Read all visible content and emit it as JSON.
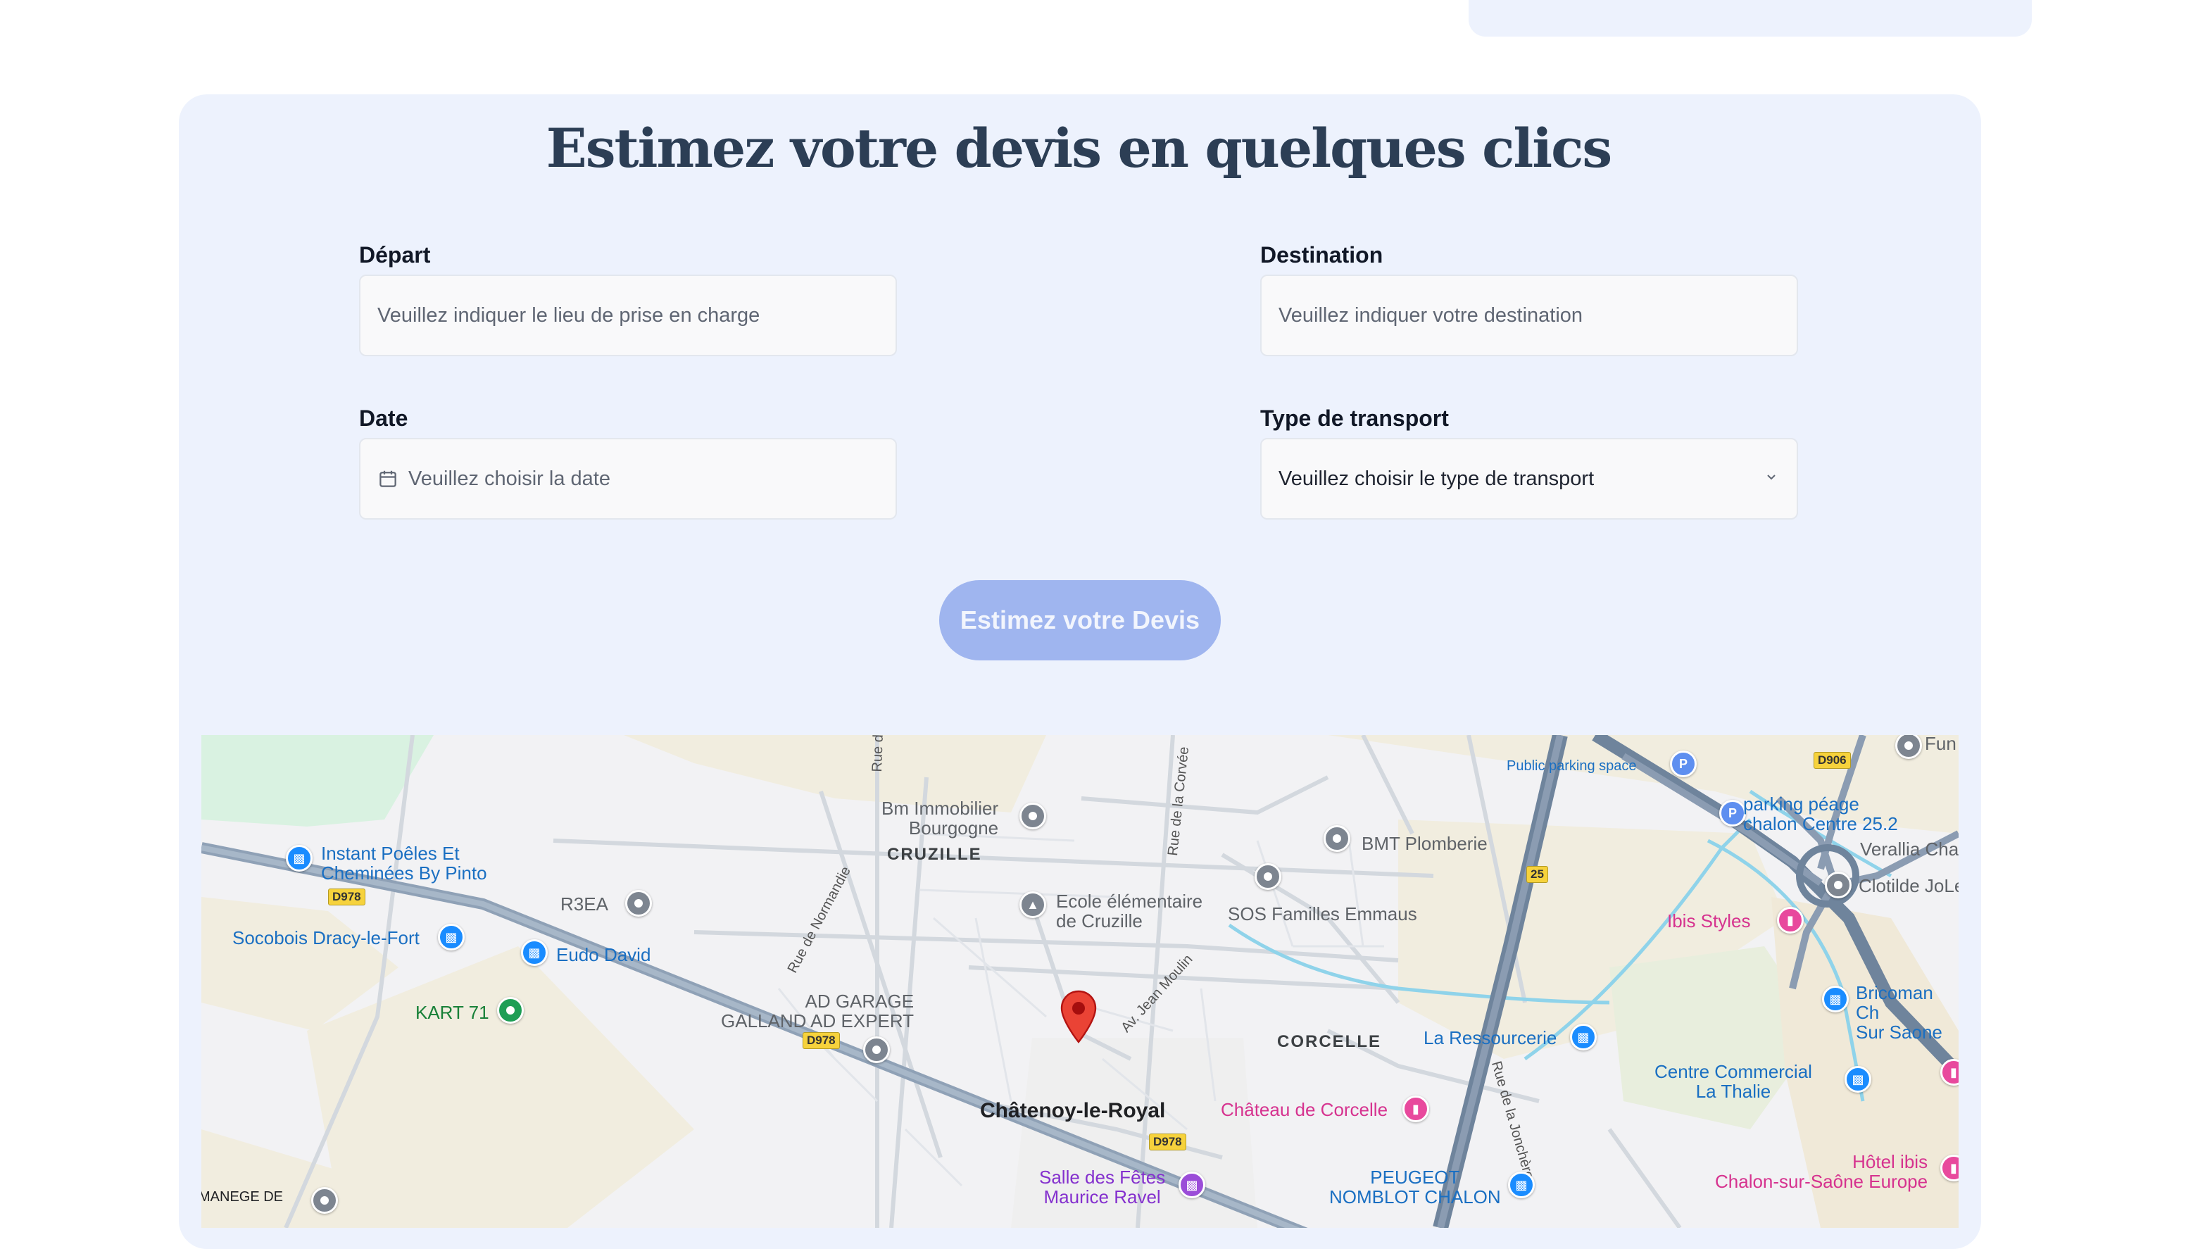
{
  "form": {
    "title": "Estimez votre devis en quelques clics",
    "depart_label": "Départ",
    "depart_placeholder": "Veuillez indiquer le lieu de prise en charge",
    "destination_label": "Destination",
    "destination_placeholder": "Veuillez indiquer votre destination",
    "date_label": "Date",
    "date_placeholder": "Veuillez choisir la date",
    "transport_label": "Type de transport",
    "transport_value": "Veuillez choisir le type de transport",
    "submit_label": "Estimez votre Devis"
  },
  "map": {
    "places": [
      {
        "text": "Instant Poêles Et\nCheminées By Pinto",
        "kind": "shop"
      },
      {
        "text": "Socobois Dracy-le-Fort",
        "kind": "shop"
      },
      {
        "text": "R3EA",
        "kind": "place"
      },
      {
        "text": "Eudo David",
        "kind": "shop"
      },
      {
        "text": "KART 71",
        "kind": "activity"
      },
      {
        "text": "AD GARAGE\nGALLAND AD EXPERT",
        "kind": "place"
      },
      {
        "text": "Bm Immobilier\nBourgogne",
        "kind": "place"
      },
      {
        "text": "Ecole élémentaire\nde Cruzille",
        "kind": "school"
      },
      {
        "text": "SOS Familles Emmaus",
        "kind": "place"
      },
      {
        "text": "BMT Plomberie",
        "kind": "place"
      },
      {
        "text": "La Ressourcerie",
        "kind": "shop"
      },
      {
        "text": "Château de Corcelle",
        "kind": "lodging"
      },
      {
        "text": "Salle des Fêtes\nMaurice Ravel",
        "kind": "venue"
      },
      {
        "text": "PEUGEOT\nNOMBLOT CHALON",
        "kind": "shop"
      },
      {
        "text": "Public parking space",
        "kind": "parking"
      },
      {
        "text": "parking péage\nchalon Centre 25.2",
        "kind": "parking"
      },
      {
        "text": "Fun",
        "kind": "place"
      },
      {
        "text": "Verallia Cha",
        "kind": "place"
      },
      {
        "text": "Clotilde JoLe",
        "kind": "place"
      },
      {
        "text": "Ibis Styles",
        "kind": "lodging"
      },
      {
        "text": "Bricoman Ch\nSur Saone",
        "kind": "shop"
      },
      {
        "text": "Centre Commercial\nLa Thalie",
        "kind": "shop"
      },
      {
        "text": "Hôtel ibis\nChalon-sur-Saône Europe",
        "kind": "lodging"
      },
      {
        "text": "MANEGE DE",
        "kind": "place"
      }
    ],
    "areas": [
      "CRUZILLE",
      "CORCELLE"
    ],
    "town": "Châtenoy-le-Royal",
    "roads": [
      "Rue de C",
      "Rue de la Corvée",
      "Rue de Normandie",
      "Av. Jean Moulin",
      "Rue de la Jonchère"
    ],
    "shields": [
      "D978",
      "D978",
      "D978",
      "25",
      "D906"
    ]
  }
}
